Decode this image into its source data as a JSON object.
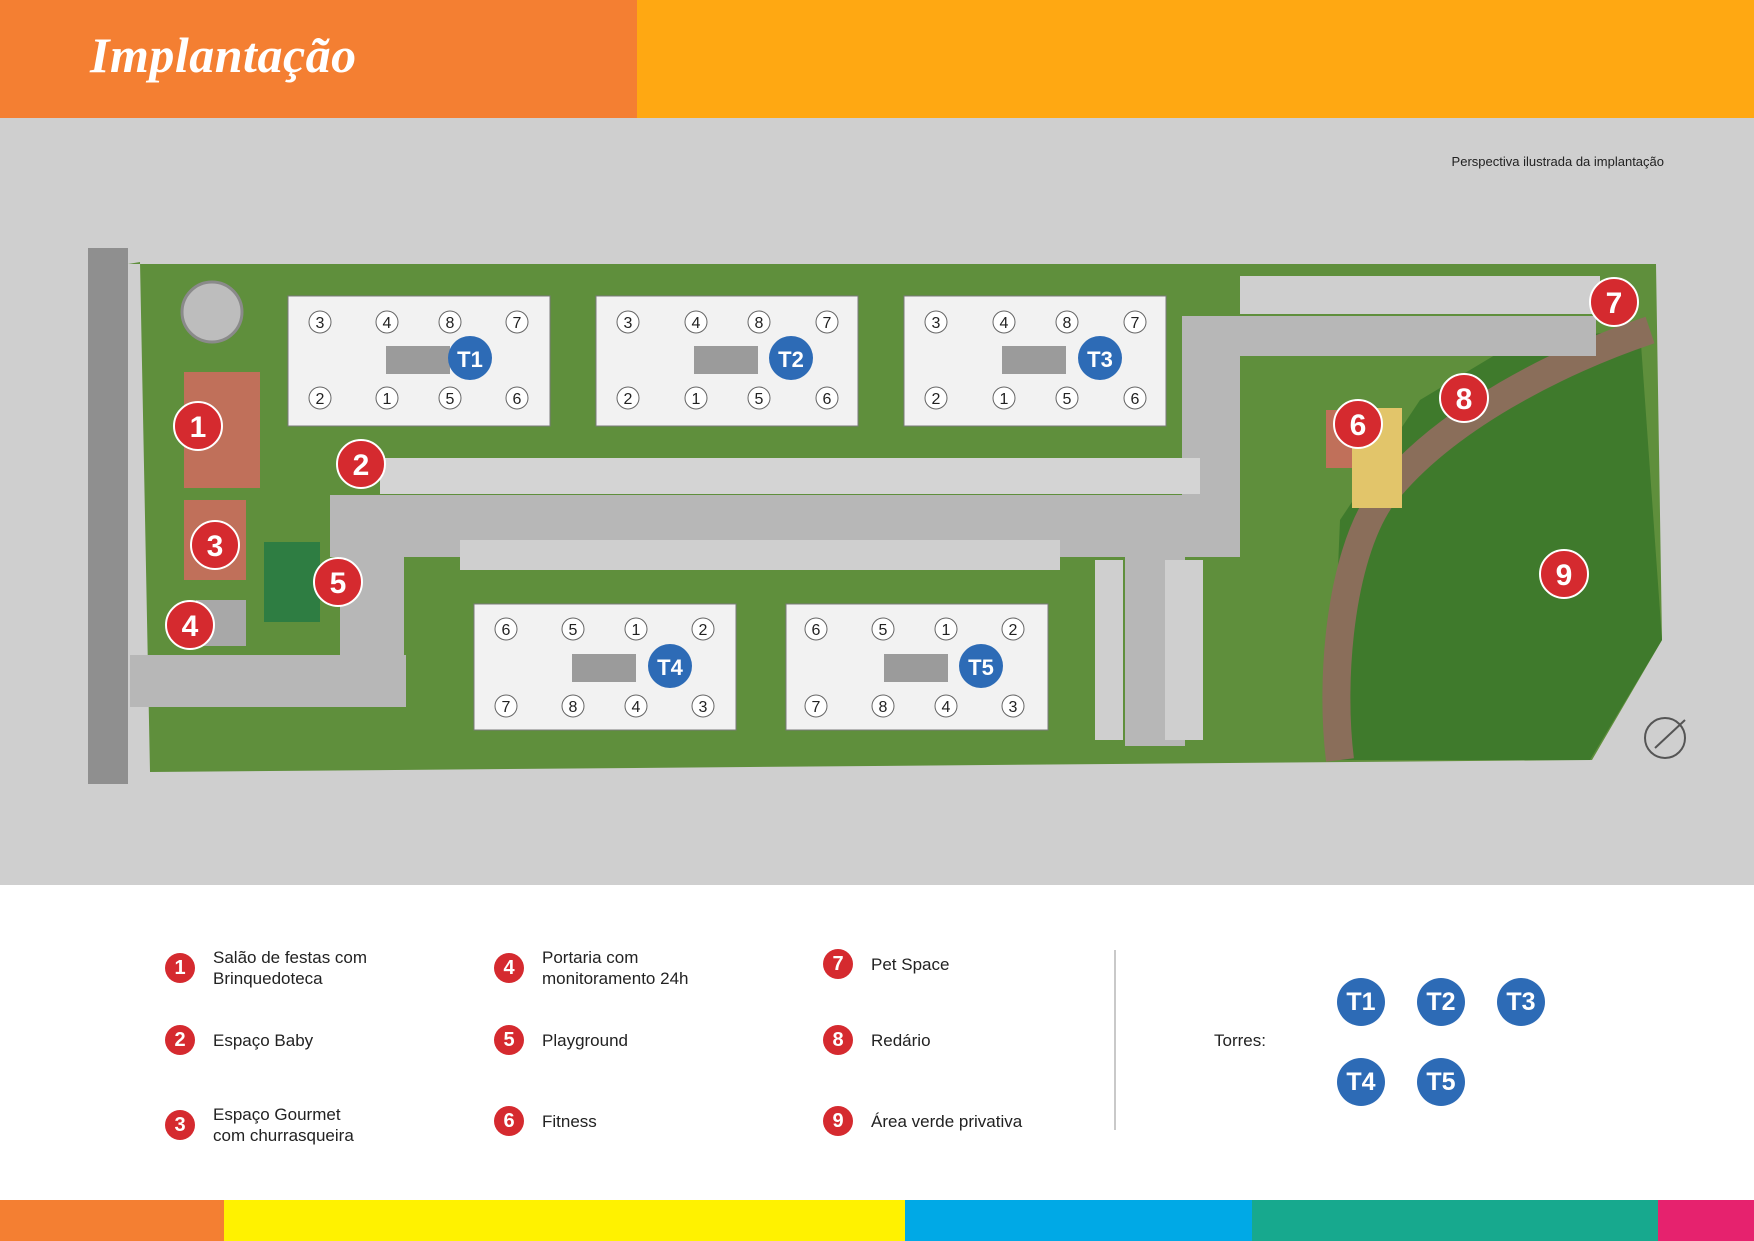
{
  "header": {
    "title": "Implantação"
  },
  "map": {
    "caption": "Perspectiva ilustrada da implantação",
    "markers": [
      "1",
      "2",
      "3",
      "4",
      "5",
      "6",
      "7",
      "8",
      "9"
    ],
    "towers": [
      "T1",
      "T2",
      "T3",
      "T4",
      "T5"
    ],
    "unit_numbers": {
      "top_row": [
        "3",
        "4",
        "8",
        "7"
      ],
      "bottom_row": [
        "2",
        "1",
        "5",
        "6"
      ],
      "south_top_row": [
        "6",
        "5",
        "1",
        "2"
      ],
      "south_bottom_row": [
        "7",
        "8",
        "4",
        "3"
      ]
    }
  },
  "legend": {
    "items": [
      {
        "num": "1",
        "text": "Salão de festas com\nBrinquedoteca"
      },
      {
        "num": "2",
        "text": "Espaço Baby"
      },
      {
        "num": "3",
        "text": "Espaço Gourmet\ncom churrasqueira"
      },
      {
        "num": "4",
        "text": "Portaria com\nmonitoramento 24h"
      },
      {
        "num": "5",
        "text": "Playground"
      },
      {
        "num": "6",
        "text": "Fitness"
      },
      {
        "num": "7",
        "text": "Pet Space"
      },
      {
        "num": "8",
        "text": "Redário"
      },
      {
        "num": "9",
        "text": "Área verde privativa"
      }
    ],
    "torres_label": "Torres:",
    "towers": [
      "T1",
      "T2",
      "T3",
      "T4",
      "T5"
    ]
  },
  "colors": {
    "header_left": "#f47f32",
    "header_right": "#ffa812",
    "marker_red": "#d52a2f",
    "tower_blue": "#2d6bb6",
    "footer_strip": [
      "#f47f32",
      "#fff200",
      "#00a9e6",
      "#17a98e",
      "#e6226e"
    ]
  }
}
